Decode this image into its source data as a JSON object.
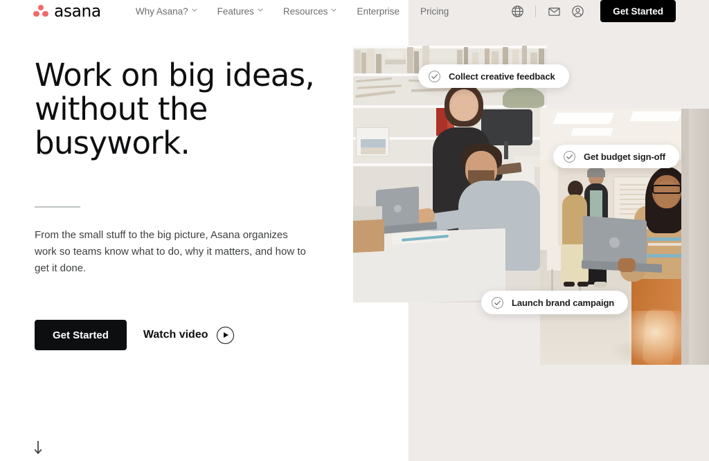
{
  "brand": {
    "name": "asana",
    "logo_icon": "asana-dots-logo",
    "accent_color": "#f06a6a"
  },
  "nav": {
    "links": [
      {
        "label": "Why Asana?",
        "has_dropdown": true
      },
      {
        "label": "Features",
        "has_dropdown": true
      },
      {
        "label": "Resources",
        "has_dropdown": true
      },
      {
        "label": "Enterprise",
        "has_dropdown": false
      },
      {
        "label": "Pricing",
        "has_dropdown": false
      }
    ],
    "icons": [
      {
        "name": "globe-icon",
        "title": "Language"
      },
      {
        "name": "envelope-icon",
        "title": "Contact sales"
      },
      {
        "name": "user-circle-icon",
        "title": "Log in"
      }
    ],
    "cta_label": "Get Started",
    "cta_bg": "#000000",
    "cta_text_color": "#ffffff"
  },
  "hero": {
    "headline": "Work on big ideas, without the busywork.",
    "headline_lines": [
      "Work on big ideas,",
      "without the",
      "busywork."
    ],
    "subcopy": "From the small stuff to the big picture, Asana organizes work so teams know what to do, why it matters, and how to get it done.",
    "primary_cta": "Get Started",
    "video_cta": "Watch video",
    "video_icon": "play-circle-icon",
    "scroll_icon": "arrow-down-icon",
    "divider_color": "#bfc4c6",
    "background_panel_color": "#efebe9"
  },
  "task_pills": [
    {
      "label": "Collect creative feedback",
      "icon": "check-circle-icon"
    },
    {
      "label": "Get budget sign-off",
      "icon": "check-circle-icon"
    },
    {
      "label": "Launch brand campaign",
      "icon": "check-circle-icon"
    }
  ],
  "photos": [
    {
      "name": "studio-team-photo",
      "alt": "Woman standing with tablet beside man working on a laptop in a design studio with bookshelves"
    },
    {
      "name": "woman-with-laptop-photo",
      "alt": "Woman in glasses holding a laptop standing in a bright open workspace"
    }
  ]
}
